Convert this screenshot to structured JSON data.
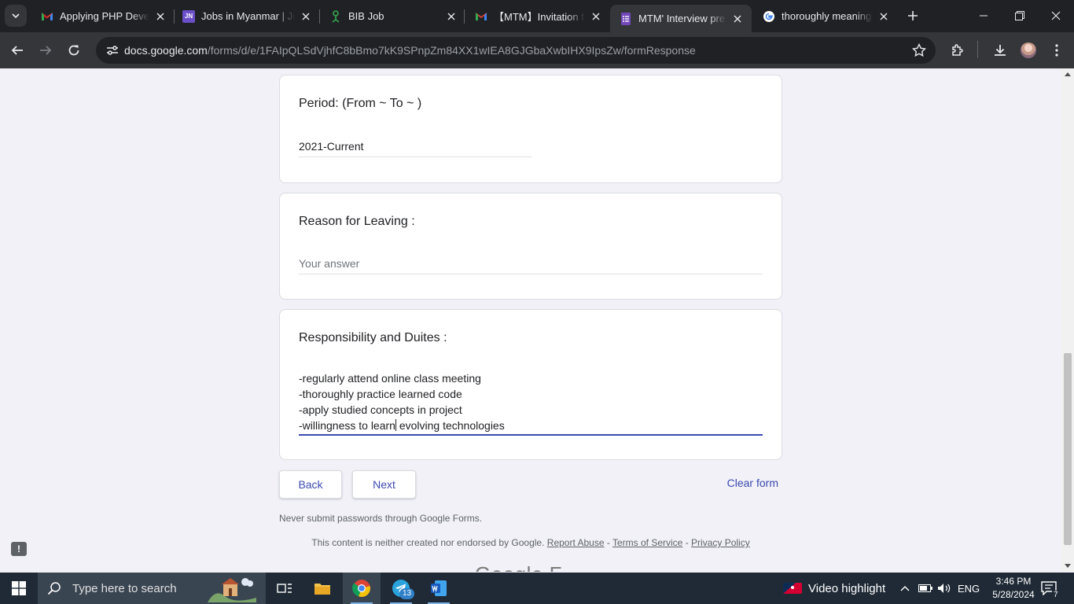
{
  "browser": {
    "tabs": [
      {
        "title": "Applying PHP Develo",
        "icon": "gmail-icon"
      },
      {
        "title": "Jobs in Myanmar | Jol",
        "icon": "jobnet-icon"
      },
      {
        "title": "BIB Job",
        "icon": "bib-icon"
      },
      {
        "title": "【MTM】Invitation for",
        "icon": "gmail-icon"
      },
      {
        "title": "MTM' Interview pre-c",
        "icon": "forms-icon",
        "active": true
      },
      {
        "title": "thoroughly meaning",
        "icon": "google-icon"
      }
    ],
    "url_host": "docs.google.com",
    "url_path": "/forms/d/e/1FAIpQLSdVjhfC8bBmo7kK9SPnpZm84XX1wIEA8GJGbaXwbIHX9IpsZw/formResponse"
  },
  "form": {
    "period": {
      "question": "Period: (From ~ To ~ )",
      "answer": "2021-Current"
    },
    "reason": {
      "question": "Reason for Leaving :",
      "placeholder": "Your answer"
    },
    "responsibility": {
      "question": "Responsibility and Duites :",
      "lines": [
        "-regularly attend online class meeting",
        "-thoroughly practice learned code",
        "-apply studied concepts in project",
        "-willingness to learn",
        " evolving technologies"
      ]
    },
    "back_label": "Back",
    "next_label": "Next",
    "clear_label": "Clear form",
    "password_note": "Never submit passwords through Google Forms.",
    "footer": {
      "text": "This content is neither created nor endorsed by Google.",
      "report": "Report Abuse",
      "terms": "Terms of Service",
      "privacy": "Privacy Policy",
      "sep": "-"
    },
    "logo_partial": "Google F"
  },
  "taskbar": {
    "search_placeholder": "Type here to search",
    "telegram_badge": "13",
    "video_highlight": "Video highlight",
    "language": "ENG",
    "time": "3:46 PM",
    "date": "5/28/2024",
    "notification_count": "7"
  },
  "colors": {
    "accent": "#3c4ab0",
    "page_bg": "#f1f1f7",
    "tab_bar": "#202124",
    "toolbar": "#35363a"
  }
}
